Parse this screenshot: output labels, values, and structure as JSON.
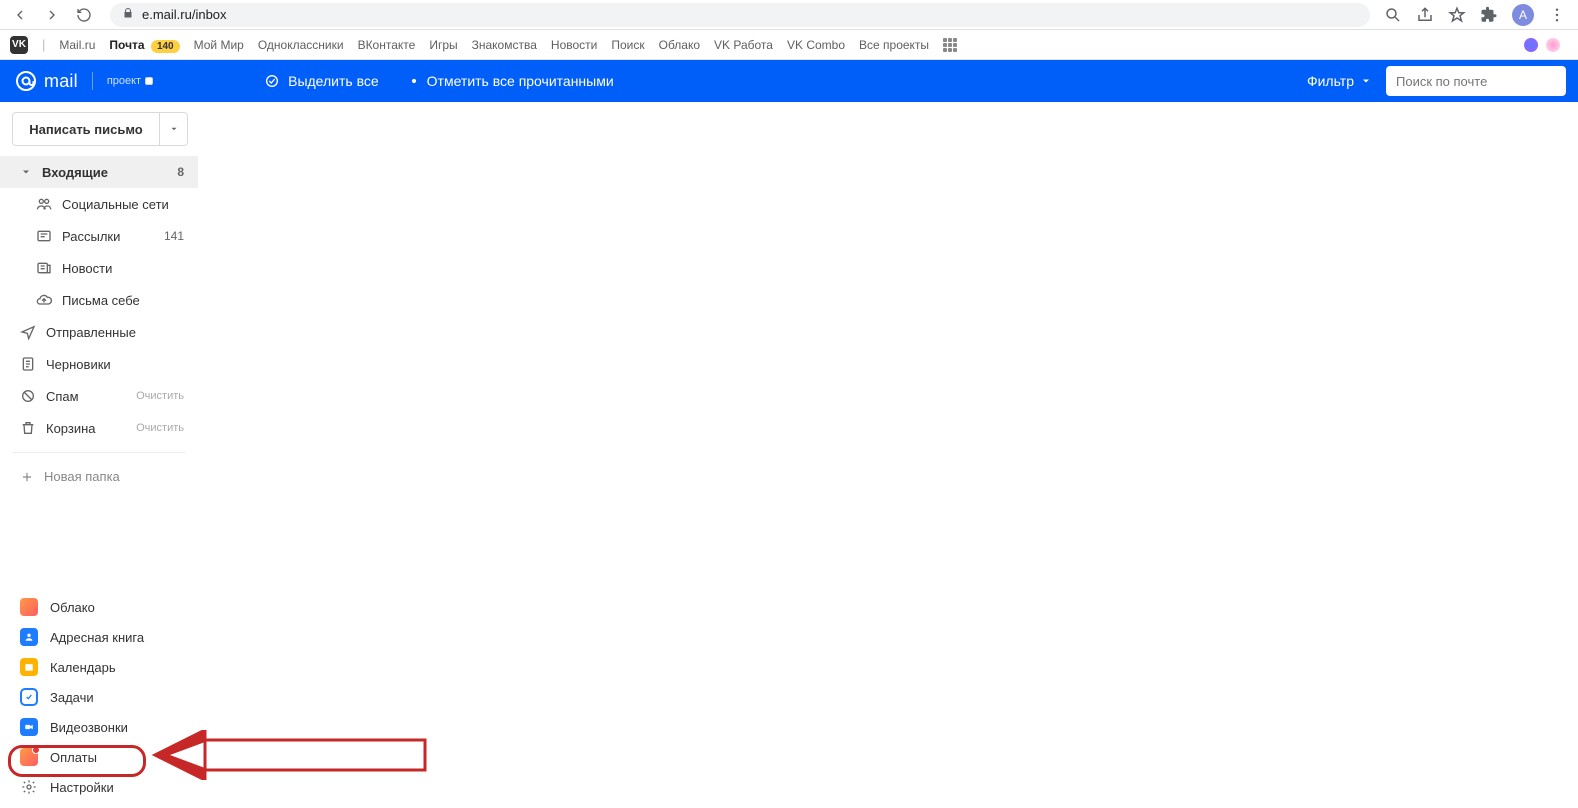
{
  "browser": {
    "url": "e.mail.ru/inbox",
    "avatar_letter": "А"
  },
  "bookmarks": {
    "items": [
      "Mail.ru",
      "Почта",
      "Мой Мир",
      "Одноклассники",
      "ВКонтакте",
      "Игры",
      "Знакомства",
      "Новости",
      "Поиск",
      "Облако",
      "VK Работа",
      "VK Combo",
      "Все проекты"
    ],
    "mail_badge": "140"
  },
  "header": {
    "logo_text": "mail",
    "project_label": "проект",
    "select_all": "Выделить все",
    "mark_read": "Отметить все прочитанными",
    "filter_label": "Фильтр",
    "search_placeholder": "Поиск по почте"
  },
  "compose": {
    "label": "Написать письмо"
  },
  "folders": {
    "inbox": {
      "label": "Входящие",
      "count": "8"
    },
    "social": {
      "label": "Социальные сети"
    },
    "newsletters": {
      "label": "Рассылки",
      "count": "141"
    },
    "news": {
      "label": "Новости"
    },
    "to_self": {
      "label": "Письма себе"
    },
    "sent": {
      "label": "Отправленные"
    },
    "drafts": {
      "label": "Черновики"
    },
    "spam": {
      "label": "Спам",
      "action": "Очистить"
    },
    "trash": {
      "label": "Корзина",
      "action": "Очистить"
    },
    "new_folder": "Новая папка"
  },
  "apps": {
    "cloud": "Облако",
    "contacts": "Адресная книга",
    "calendar": "Календарь",
    "tasks": "Задачи",
    "video": "Видеозвонки",
    "payments": "Оплаты",
    "settings": "Настройки"
  }
}
